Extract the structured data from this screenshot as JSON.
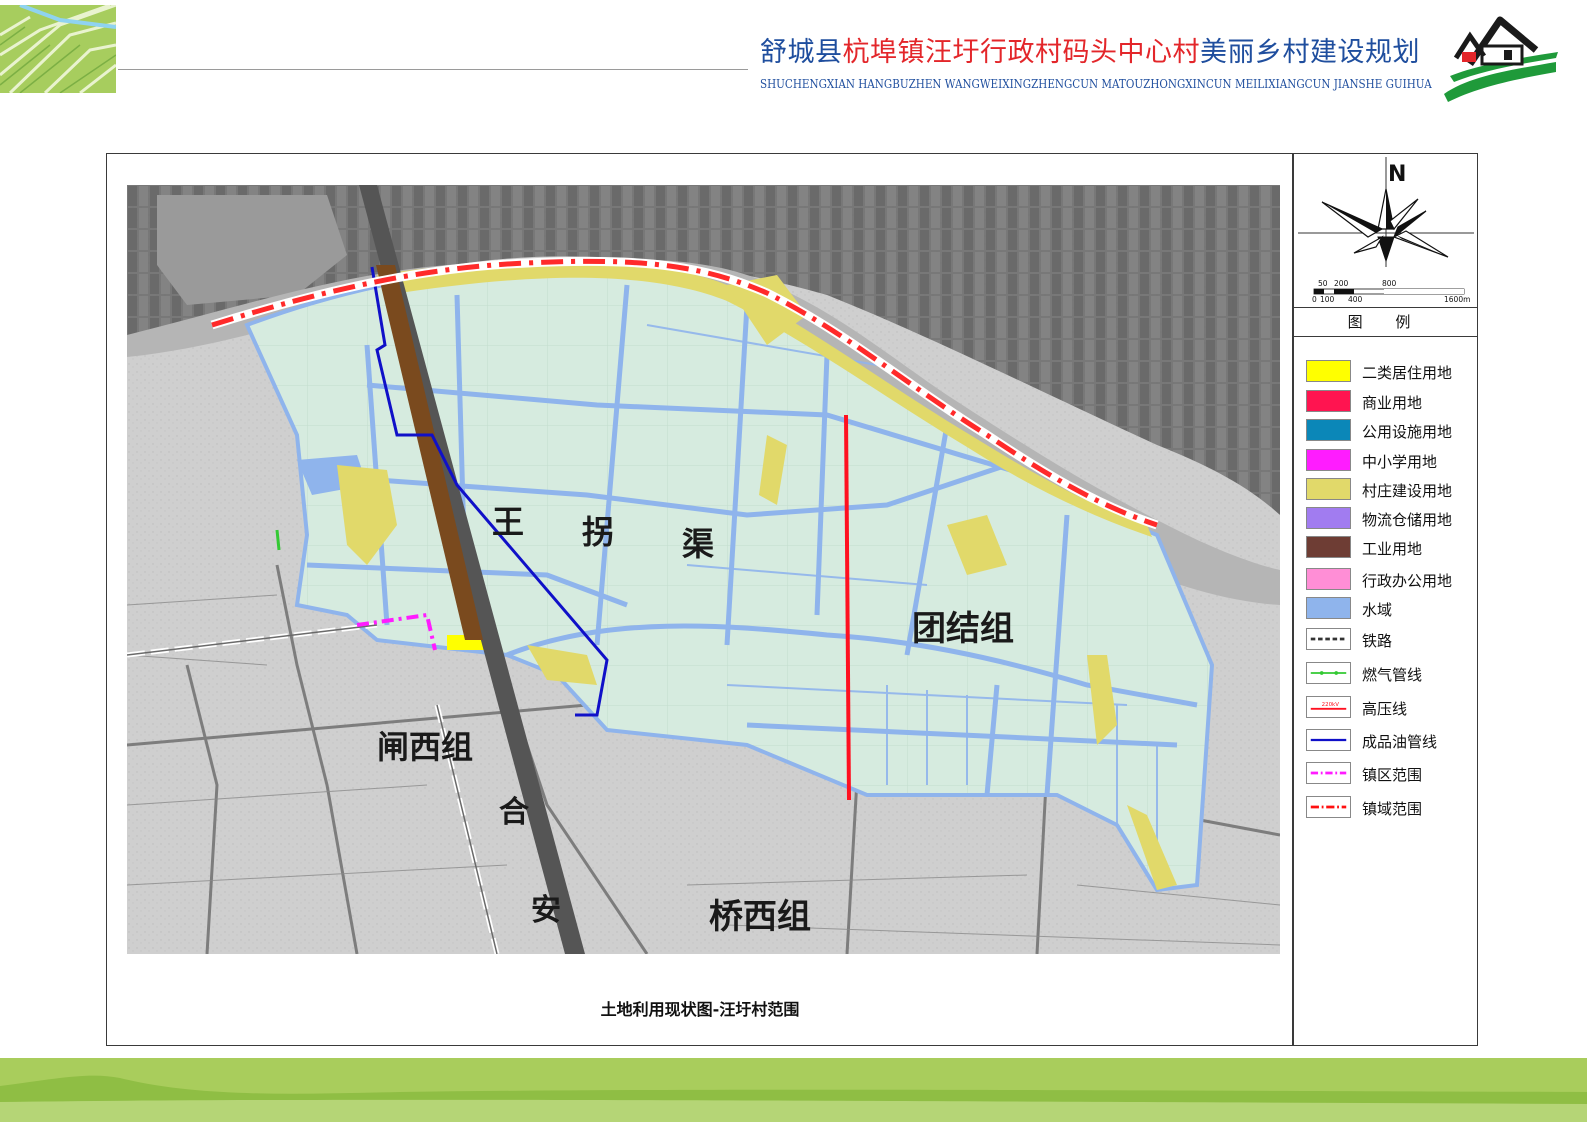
{
  "header": {
    "title_parts": [
      {
        "text": "舒城县",
        "color": "#1f4e9e"
      },
      {
        "text": "杭埠镇汪圩行政村码头中心村",
        "color": "#e3262a"
      },
      {
        "text": "美丽乡村建设规划",
        "color": "#1f4e9e"
      }
    ],
    "subtitle": "SHUCHENGXIAN HANGBUZHEN WANGWEIXINGZHENGCUN MATOUZHONGXINCUN MEILIXIANGCUN JIANSHE GUIHUA"
  },
  "map": {
    "caption": "土地利用现状图-汪圩村范围",
    "labels": {
      "channel": [
        "王",
        "拐",
        "渠"
      ],
      "tuanjie": "团结组",
      "zhaxi": "闸西组",
      "qiaoxi": "桥西组",
      "highway": [
        "合",
        "安"
      ]
    },
    "colors": {
      "residential": "#ffff00",
      "village_construction": "#e1d96a",
      "water": "#8fb4ec",
      "industrial_highway": "#7a4a1e",
      "high_voltage": "#ff1020",
      "pipeline": "#1010c8",
      "boundary": "#ff2a2a",
      "town_area": "#ff1cff"
    }
  },
  "compass": {
    "north": "N",
    "scale_top": [
      "50",
      "200",
      "800"
    ],
    "scale_bottom": [
      "0",
      "100",
      "400",
      "1600m"
    ]
  },
  "legend": {
    "title": "图 例",
    "items": [
      {
        "label": "二类居住用地",
        "color": "#ffff00",
        "kind": "fill"
      },
      {
        "label": "商业用地",
        "color": "#ff1450",
        "kind": "fill"
      },
      {
        "label": "公用设施用地",
        "color": "#0b87b8",
        "kind": "fill"
      },
      {
        "label": "中小学用地",
        "color": "#ff1cff",
        "kind": "fill"
      },
      {
        "label": "村庄建设用地",
        "color": "#e1d96a",
        "kind": "fill"
      },
      {
        "label": "物流仓储用地",
        "color": "#a17cf0",
        "kind": "fill"
      },
      {
        "label": "工业用地",
        "color": "#6e3d34",
        "kind": "fill"
      },
      {
        "label": "行政办公用地",
        "color": "#ff8ed6",
        "kind": "fill"
      },
      {
        "label": "水域",
        "color": "#8fb4ec",
        "kind": "fill"
      },
      {
        "label": "铁路",
        "color": "#333333",
        "kind": "rail"
      },
      {
        "label": "燃气管线",
        "color": "#33c933",
        "kind": "gas"
      },
      {
        "label": "高压线",
        "color": "#ff1020",
        "kind": "hv",
        "mark": "220kV"
      },
      {
        "label": "成品油管线",
        "color": "#1010c8",
        "kind": "oil"
      },
      {
        "label": "镇区范围",
        "color": "#ff1cff",
        "kind": "town"
      },
      {
        "label": "镇域范围",
        "color": "#ff1010",
        "kind": "boundary"
      }
    ]
  }
}
